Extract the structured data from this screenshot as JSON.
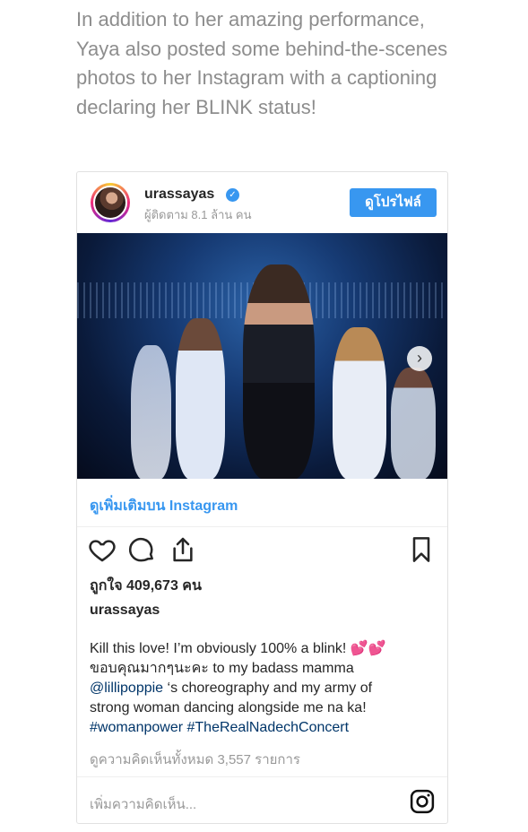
{
  "article": {
    "intro": "In addition to her amazing performance, Yaya also posted some behind-the-scenes photos to her Instagram with a captioning declaring her BLINK status!"
  },
  "embed": {
    "username": "urassayas",
    "followers": "ผู้ติดตาม 8.1 ล้าน คน",
    "profile_button": "ดูโปรไฟล์",
    "more_link": "ดูเพิ่มเติมบน Instagram",
    "likes": "ถูกใจ 409,673 คน",
    "caption_owner": "urassayas",
    "caption_line1": "Kill this love! I’m obviously 100% a blink! 💕💕",
    "caption_line2": "ขอบคุณมากๆนะคะ to my badass mamma",
    "caption_mention": "@lillipoppie",
    "caption_line3_rest": " ‘s choreography and my army of",
    "caption_line4": "strong woman dancing alongside me na ka!",
    "caption_tags": "#womanpower #TheRealNadechConcert",
    "comments": "ดูความคิดเห็นทั้งหมด 3,557 รายการ",
    "comment_placeholder": "เพิ่มความคิดเห็น..."
  },
  "icons": {
    "verified": "verified-badge-icon",
    "like": "heart-icon",
    "comment": "comment-bubble-icon",
    "share": "share-icon",
    "save": "bookmark-icon",
    "next": "chevron-right-icon",
    "instagram": "instagram-logo-icon"
  },
  "colors": {
    "accent": "#3897f0",
    "text": "#262626",
    "muted": "#999999",
    "intro_text": "#8d8d8d",
    "mention": "#003569"
  }
}
